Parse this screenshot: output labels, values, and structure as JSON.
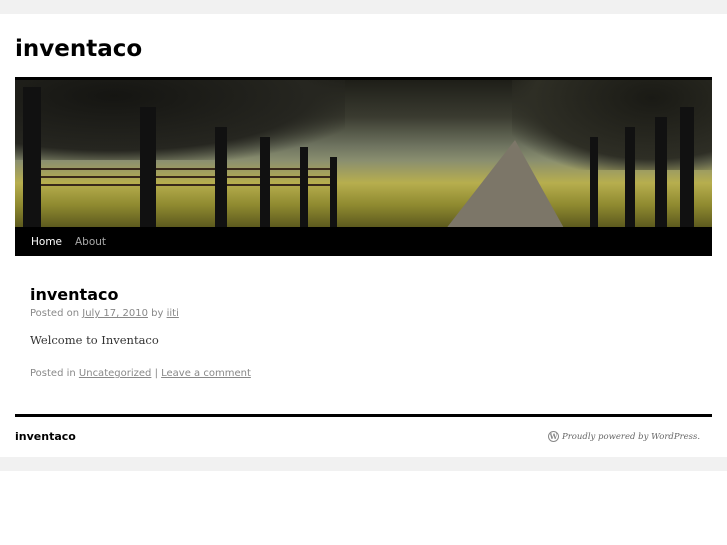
{
  "site": {
    "title": "inventaco"
  },
  "nav": {
    "items": [
      {
        "label": "Home"
      },
      {
        "label": "About"
      }
    ]
  },
  "post": {
    "title": "inventaco",
    "posted_on": "Posted on",
    "date": "July 17, 2010",
    "by": "by",
    "author": "iiti",
    "content": "Welcome to Inventaco",
    "posted_in": "Posted in",
    "category": "Uncategorized",
    "separator": "|",
    "comment_link": "Leave a comment"
  },
  "footer": {
    "site_title": "inventaco",
    "powered_by": "Proudly powered by WordPress.",
    "icon": "wordpress-logo-icon"
  },
  "colors": {
    "nav_bg": "#000000",
    "page_bg": "#f1f1f1",
    "meta_text": "#888888"
  }
}
